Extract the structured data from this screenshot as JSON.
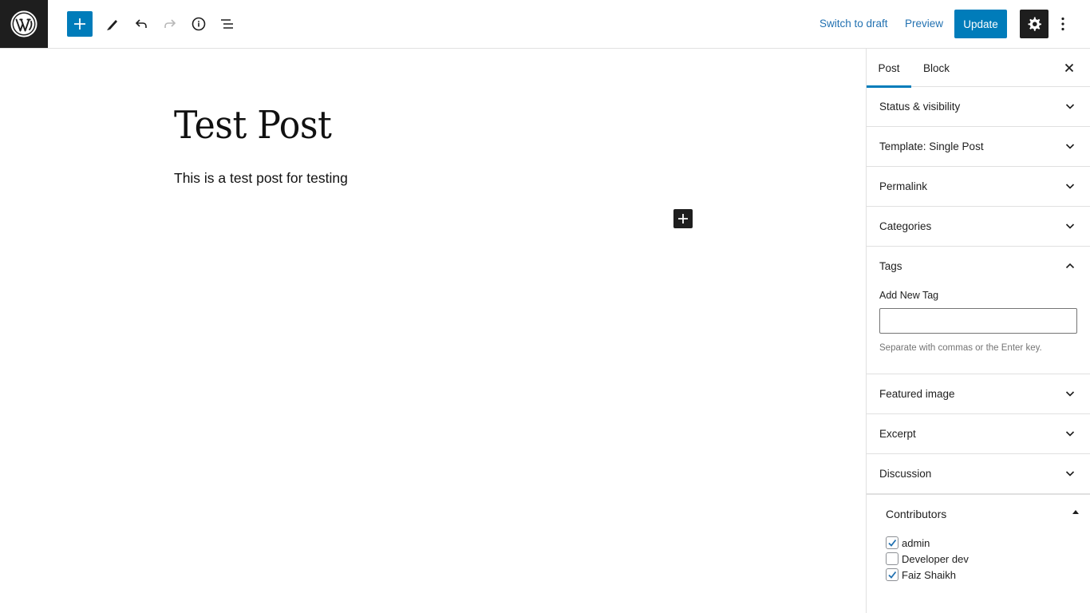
{
  "toolbar": {
    "logo_icon": "wordpress-logo-icon",
    "add_icon": "plus-icon",
    "edit_icon": "pencil-icon",
    "undo_icon": "undo-icon",
    "redo_icon": "redo-icon",
    "info_icon": "info-icon",
    "list_view_icon": "list-view-icon",
    "switch_to_draft": "Switch to draft",
    "preview": "Preview",
    "update": "Update",
    "settings_icon": "gear-icon",
    "more_icon": "more-vertical-icon",
    "accent_color": "#007cba"
  },
  "editor": {
    "title": "Test Post",
    "paragraph": "This is a test post for testing"
  },
  "sidebar": {
    "tabs": [
      {
        "label": "Post",
        "active": true
      },
      {
        "label": "Block",
        "active": false
      }
    ],
    "panels": [
      {
        "label": "Status & visibility",
        "expanded": false
      },
      {
        "label": "Template: Single Post",
        "expanded": false
      },
      {
        "label": "Permalink",
        "expanded": false
      },
      {
        "label": "Categories",
        "expanded": false
      },
      {
        "label": "Tags",
        "expanded": true
      },
      {
        "label": "Featured image",
        "expanded": false
      },
      {
        "label": "Excerpt",
        "expanded": false
      },
      {
        "label": "Discussion",
        "expanded": false
      }
    ],
    "tags": {
      "label": "Add New Tag",
      "value": "",
      "help": "Separate with commas or the Enter key."
    },
    "contributors": {
      "title": "Contributors",
      "items": [
        {
          "name": "admin",
          "checked": true
        },
        {
          "name": "Developer dev",
          "checked": false
        },
        {
          "name": "Faiz Shaikh",
          "checked": true
        }
      ]
    }
  }
}
